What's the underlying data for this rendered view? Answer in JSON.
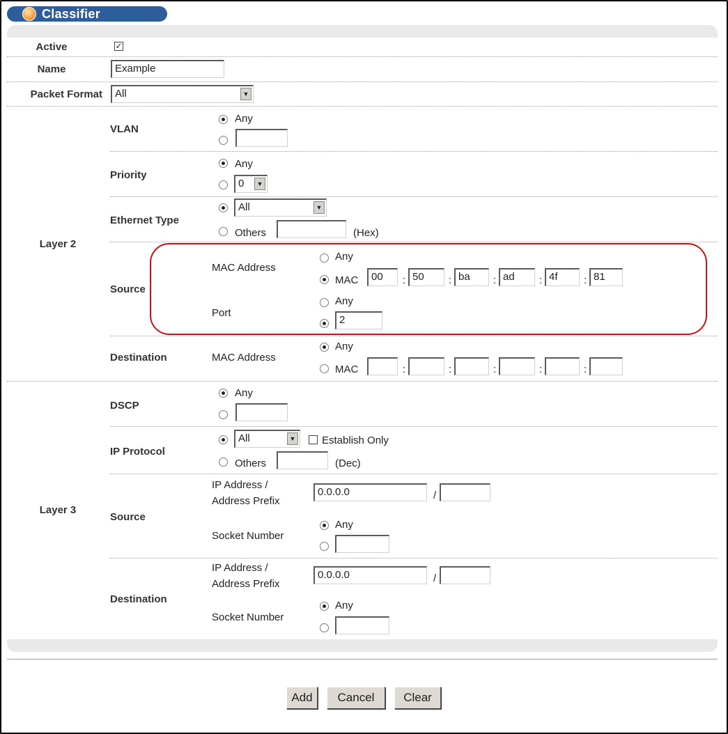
{
  "title": "Classifier",
  "general": {
    "active_label": "Active",
    "active_checked": true,
    "name_label": "Name",
    "name_value": "Example",
    "packet_format_label": "Packet Format",
    "packet_format_value": "All"
  },
  "layer2": {
    "label": "Layer 2",
    "vlan": {
      "label": "VLAN",
      "any": "Any",
      "value": ""
    },
    "priority": {
      "label": "Priority",
      "any": "Any",
      "value": "0"
    },
    "ethernet_type": {
      "label": "Ethernet Type",
      "select_value": "All",
      "others": "Others",
      "others_value": "",
      "unit": "(Hex)"
    },
    "source": {
      "label": "Source",
      "mac_label": "MAC Address",
      "any": "Any",
      "mac": "MAC",
      "mac_octets": [
        "00",
        "50",
        "ba",
        "ad",
        "4f",
        "81"
      ],
      "port_label": "Port",
      "port_any": "Any",
      "port_value": "2"
    },
    "destination": {
      "label": "Destination",
      "mac_label": "MAC Address",
      "any": "Any",
      "mac": "MAC",
      "mac_octets": [
        "",
        "",
        "",
        "",
        "",
        ""
      ]
    }
  },
  "layer3": {
    "label": "Layer 3",
    "dscp": {
      "label": "DSCP",
      "any": "Any",
      "value": ""
    },
    "ip_protocol": {
      "label": "IP Protocol",
      "select_value": "All",
      "establish_only": "Establish Only",
      "others": "Others",
      "others_value": "",
      "unit": "(Dec)"
    },
    "source": {
      "label": "Source",
      "ip_label_1": "IP Address /",
      "ip_label_2": "Address Prefix",
      "ip_value": "0.0.0.0",
      "slash": "/",
      "prefix_value": "",
      "socket_label": "Socket Number",
      "any": "Any",
      "socket_value": ""
    },
    "destination": {
      "label": "Destination",
      "ip_label_1": "IP Address /",
      "ip_label_2": "Address Prefix",
      "ip_value": "0.0.0.0",
      "slash": "/",
      "prefix_value": "",
      "socket_label": "Socket Number",
      "any": "Any",
      "socket_value": ""
    }
  },
  "buttons": {
    "add": "Add",
    "cancel": "Cancel",
    "clear": "Clear"
  },
  "colors": {
    "title_bar": "#2d5d9b",
    "panel": "#e9e9e9",
    "highlight": "#cc1111"
  }
}
